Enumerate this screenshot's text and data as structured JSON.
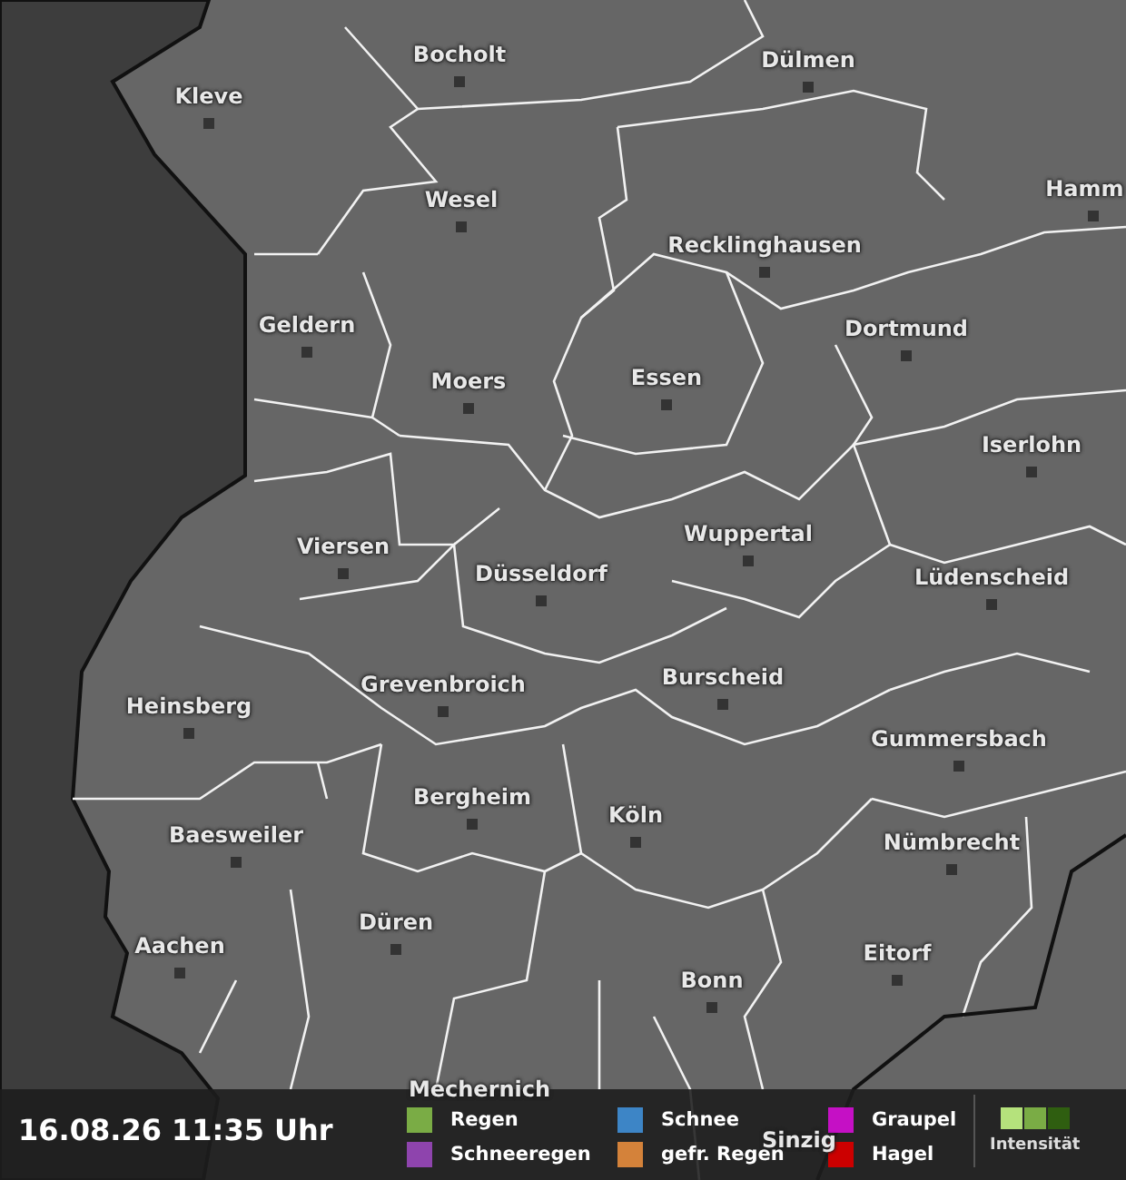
{
  "map": {
    "cities": [
      {
        "name": "Bocholt"
      },
      {
        "name": "Kleve"
      },
      {
        "name": "Dülmen"
      },
      {
        "name": "Hamm"
      },
      {
        "name": "Wesel"
      },
      {
        "name": "Recklinghausen"
      },
      {
        "name": "Geldern"
      },
      {
        "name": "Dortmund"
      },
      {
        "name": "Moers"
      },
      {
        "name": "Essen"
      },
      {
        "name": "Iserlohn"
      },
      {
        "name": "Wuppertal"
      },
      {
        "name": "Viersen"
      },
      {
        "name": "Düsseldorf"
      },
      {
        "name": "Lüdenscheid"
      },
      {
        "name": "Burscheid"
      },
      {
        "name": "Grevenbroich"
      },
      {
        "name": "Heinsberg"
      },
      {
        "name": "Gummersbach"
      },
      {
        "name": "Bergheim"
      },
      {
        "name": "Köln"
      },
      {
        "name": "Baesweiler"
      },
      {
        "name": "Nümbrecht"
      },
      {
        "name": "Düren"
      },
      {
        "name": "Aachen"
      },
      {
        "name": "Eitorf"
      },
      {
        "name": "Bonn"
      },
      {
        "name": "Mechernich"
      },
      {
        "name": "Sinzig"
      }
    ]
  },
  "footer": {
    "timestamp": "16.08.26 11:35 Uhr",
    "legend": [
      {
        "label": "Regen",
        "color": "#7aac45"
      },
      {
        "label": "Schneeregen",
        "color": "#8e44ad"
      },
      {
        "label": "Schnee",
        "color": "#3d85c6"
      },
      {
        "label": "gefr. Regen",
        "color": "#d4823a"
      },
      {
        "label": "Graupel",
        "color": "#c510c5"
      },
      {
        "label": "Hagel",
        "color": "#cc0000"
      }
    ],
    "intensity": {
      "label": "Intensität",
      "steps": [
        {
          "color": "#b5e27c"
        },
        {
          "color": "#7aac45"
        },
        {
          "color": "#2f5e10"
        }
      ]
    }
  }
}
